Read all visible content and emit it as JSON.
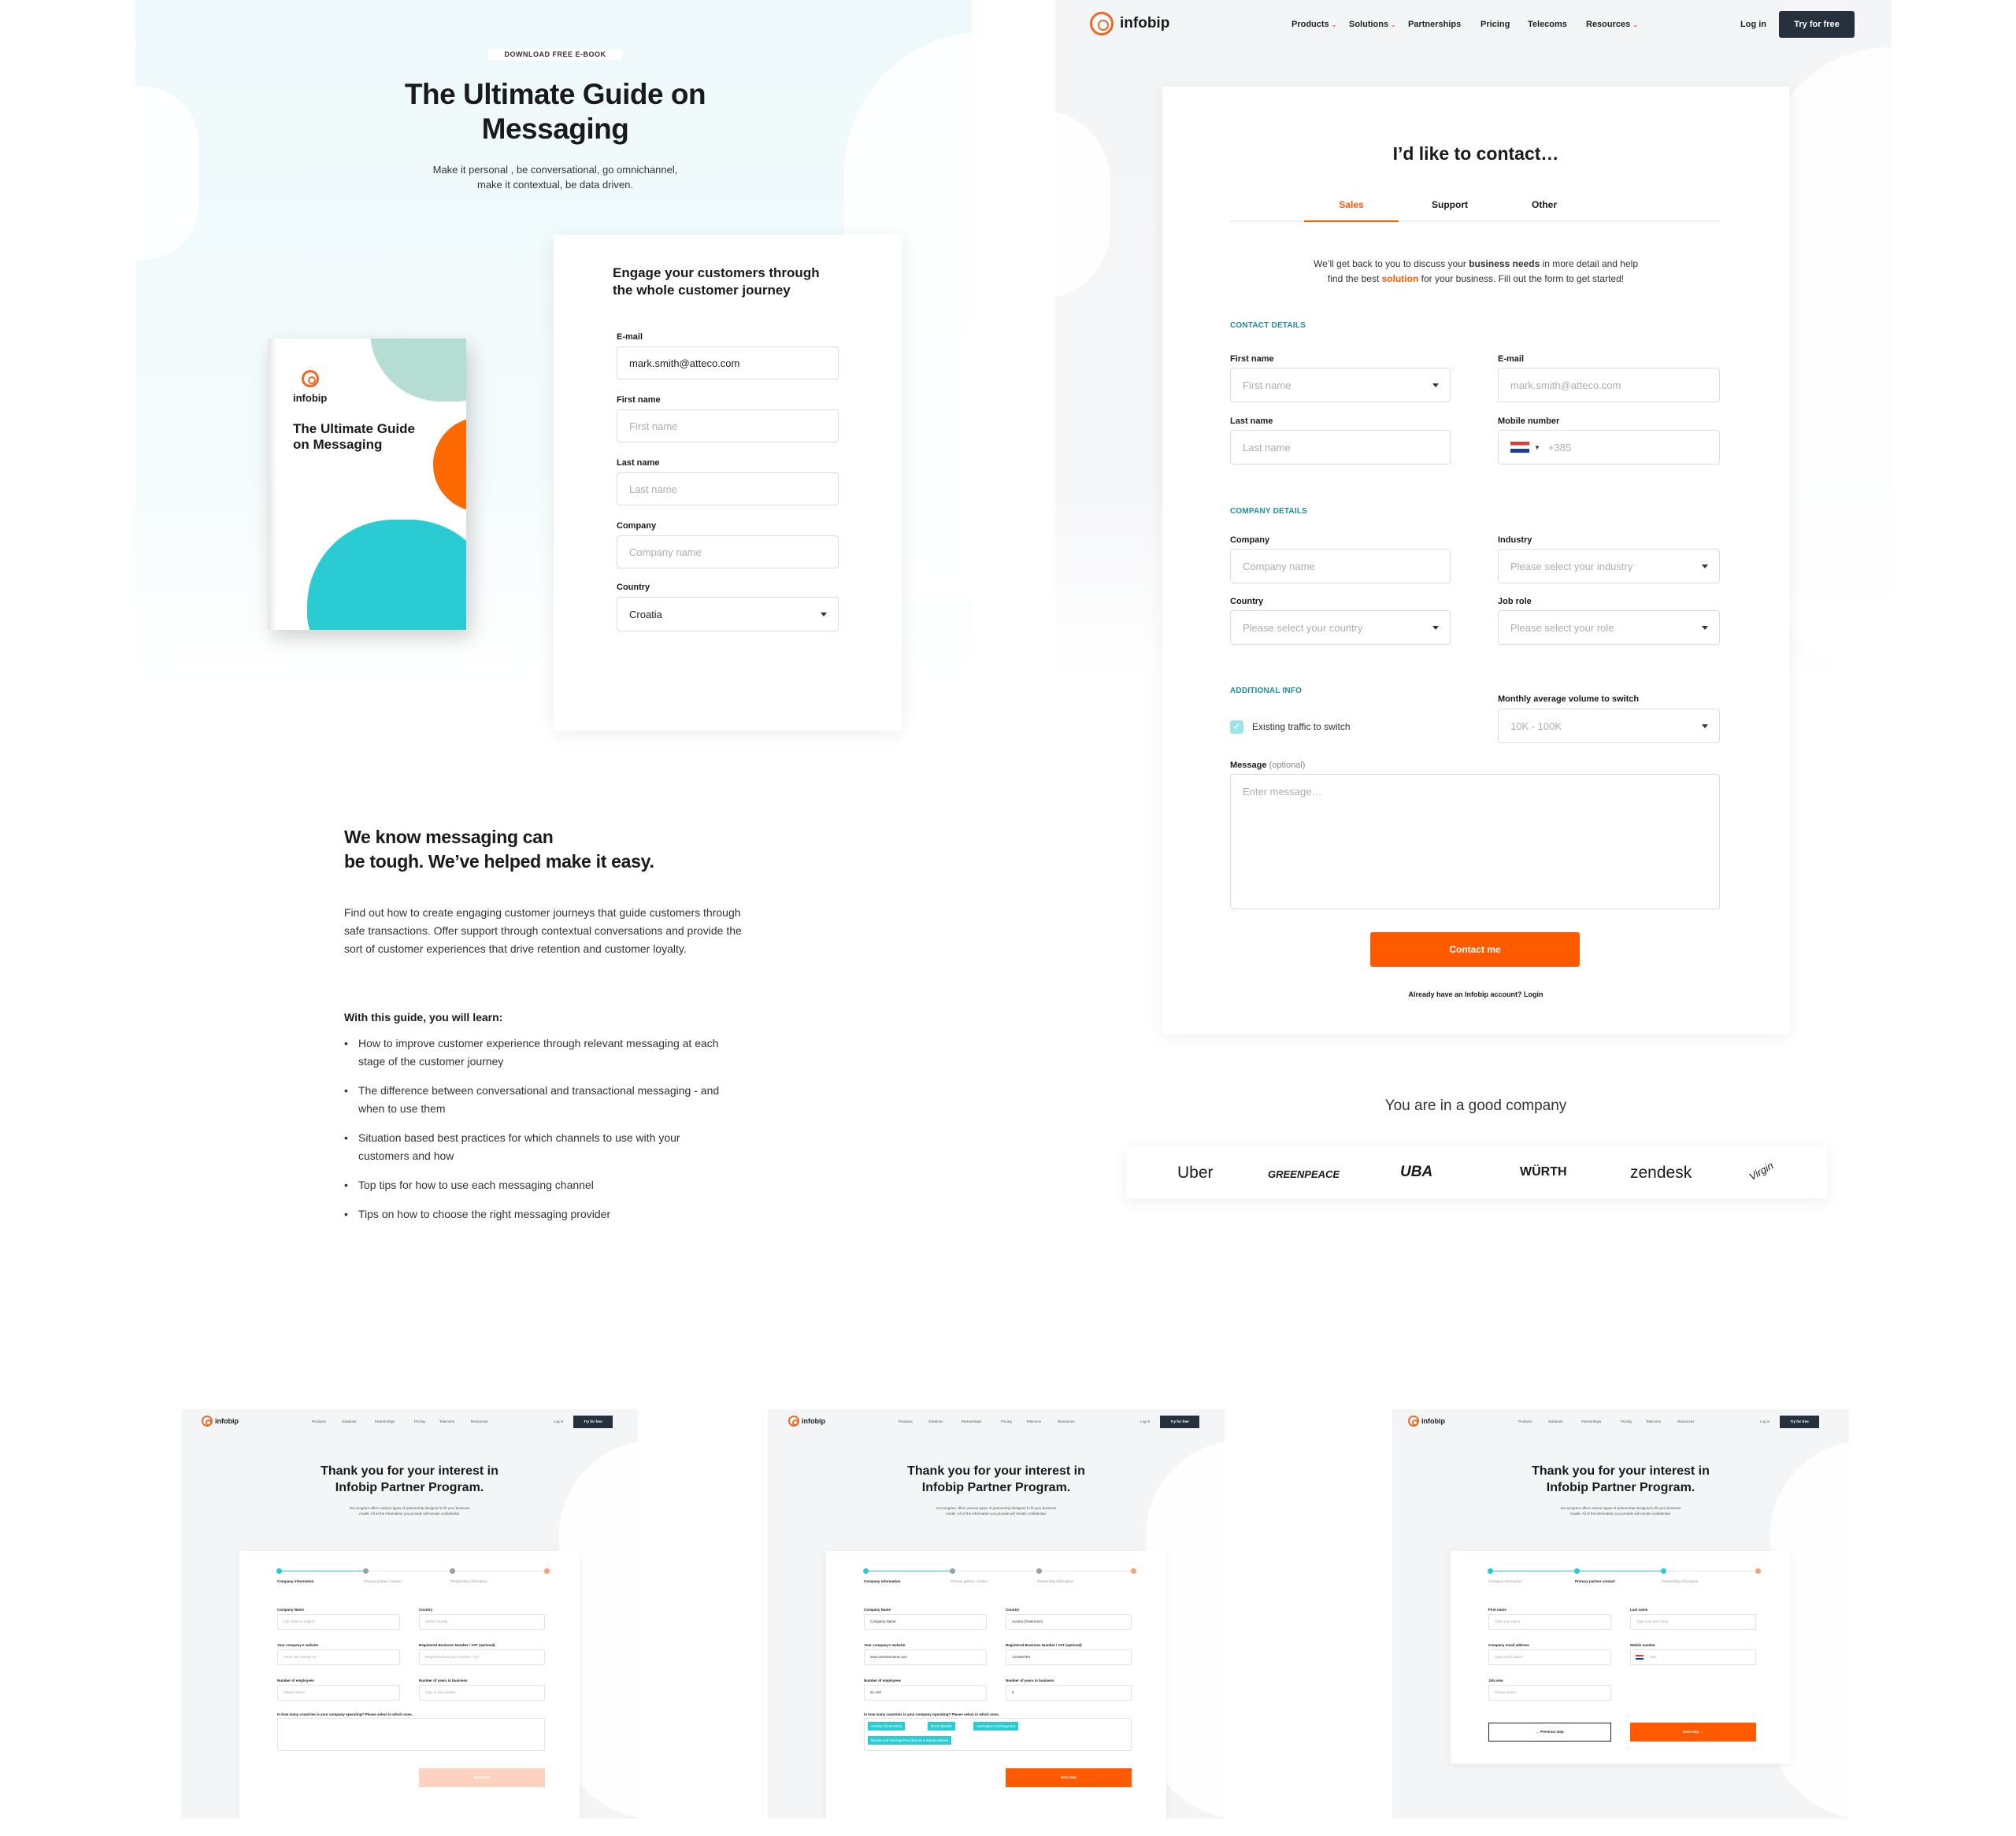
{
  "ebook": {
    "eyebrow": "DOWNLOAD FREE E-BOOK",
    "title_line1": "The Ultimate Guide on",
    "title_line2": "Messaging",
    "subtitle_line1": "Make it personal , be conversational, go omnichannel,",
    "subtitle_line2": "make it contextual, be data driven.",
    "book_brand": "infobip",
    "book_title_line1": "The Ultimate Guide",
    "book_title_line2": "on Messaging",
    "form_title_line1": "Engage your customers through",
    "form_title_line2": "the whole customer journey",
    "email_label": "E-mail",
    "email_value": "mark.smith@atteco.com",
    "first_name_label": "First name",
    "first_name_placeholder": "First name",
    "last_name_label": "Last name",
    "last_name_placeholder": "Last name",
    "company_label": "Company",
    "company_placeholder": "Company name",
    "country_label": "Country",
    "country_value": "Croatia",
    "section2_title_line1": "We know messaging can",
    "section2_title_line2": "be tough. We’ve helped make it easy.",
    "section2_para": "Find out how to create engaging customer journeys that guide customers through safe transactions. Offer support through contextual conversations and provide the sort of customer experiences that drive retention and customer loyalty.",
    "learn_heading": "With this guide, you will learn:",
    "learn_items": [
      "How to improve customer experience through relevant messaging at each stage of the customer journey",
      "The difference between conversational and transactional messaging - and when to use them",
      "Situation based best practices for which channels to use with your customers and how",
      "Top tips for how to use each messaging channel",
      "Tips on how to choose the right messaging provider"
    ]
  },
  "header": {
    "brand": "infobip",
    "nav": [
      "Products",
      "Solutions",
      "Partnerships",
      "Pricing",
      "Telecoms",
      "Resources"
    ],
    "login": "Log in",
    "try": "Try for free"
  },
  "contact": {
    "title": "I’d like to contact…",
    "tabs": [
      "Sales",
      "Support",
      "Other"
    ],
    "intro_pre": "We’ll get back to you to discuss your ",
    "intro_bold": "business needs",
    "intro_mid": " in more detail and help",
    "intro_line2_pre": "find the best ",
    "intro_orange": "solution",
    "intro_post": " for your business. Fill out the form to get started!",
    "contact_details": "CONTACT DETAILS",
    "first_name_label": "First name",
    "first_name_placeholder": "First name",
    "email_label": "E-mail",
    "email_placeholder": "mark.smith@atteco.com",
    "last_name_label": "Last name",
    "last_name_placeholder": "Last name",
    "mobile_label": "Mobile number",
    "mobile_placeholder": "+385",
    "company_details": "COMPANY DETAILS",
    "company_label": "Company",
    "company_placeholder": "Company name",
    "industry_label": "Industry",
    "industry_placeholder": "Please select your industry",
    "country_label": "Country",
    "country_placeholder": "Please select your country",
    "role_label": "Job role",
    "role_placeholder": "Please select your role",
    "additional_info": "ADDITIONAL INFO",
    "checkbox_label": "Existing traffic to switch",
    "volume_label": "Monthly average volume to switch",
    "volume_value": "10K - 100K",
    "message_label": "Message",
    "message_optional": "(optional)",
    "message_placeholder": "Enter message…",
    "submit": "Contact me",
    "account_note": "Already have an Infobip account? Login",
    "good_company": "You are in a good company",
    "logos": [
      "Uber",
      "GREENPEACE",
      "UBA",
      "WÜRTH",
      "zendesk",
      "Virgin"
    ]
  },
  "partner": {
    "title_line1": "Thank you for your interest in",
    "title_line2": "Infobip Partner Program.",
    "desc_line1": "Our program offers various types of partnership designed to fit your business",
    "desc_line2": "model.  All of the information you provide will remain confidential.",
    "steps": [
      "Company information",
      "Primary partner contact",
      "Partnership information"
    ],
    "s1": {
      "company_name": "Company Name",
      "company_name_ph": "Full name in english",
      "country": "Country",
      "country_ph": "Select country",
      "website": "Your company's website",
      "website_ph": "Paste the website url",
      "reg": "Registered Business Number / VAT (optional)",
      "reg_ph": "Registered business number / VAT",
      "employees": "Number of employees",
      "employees_ph": "Please select",
      "years": "Number of years in business",
      "years_ph": "Type in the number",
      "countries_q": "In how many countries is your company operating? Please select in which ones.",
      "next": "Next step"
    },
    "s2": {
      "company_name_val": "Company Name",
      "country_val": "Austria (Österreich)",
      "website_val": "www.websitename.com",
      "reg_val": "1234567BX",
      "employees_val": "51-100",
      "years_val": "8",
      "chips": [
        "Austria (Österreich)",
        "Brazil (Brasil)",
        "Azerbaijan (Azərbaycan)",
        "Bosnia and Herzegovina (Босна и Херцеговина)"
      ]
    },
    "s3": {
      "first": "First name",
      "first_ph": "Type your name",
      "last": "Last name",
      "last_ph": "Type your last name",
      "email": "Company email address",
      "email_ph": "Type email adress",
      "mobile": "Mobile number",
      "mobile_ph": "+385",
      "job": "Job area",
      "job_ph": "Please select",
      "prev": "Previous step"
    }
  },
  "colors": {
    "accent": "#ff5a00",
    "teal": "#2bcbd4",
    "dark": "#27313d",
    "sec": "#1b8fa0"
  }
}
